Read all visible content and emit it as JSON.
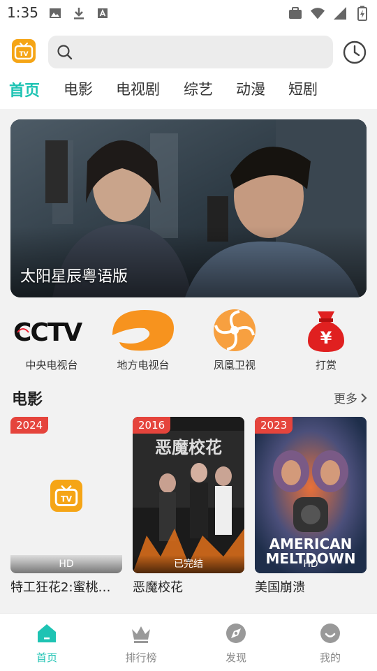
{
  "status_bar": {
    "time": "1:35"
  },
  "header": {
    "search": {
      "placeholder": "",
      "value": ""
    }
  },
  "tabs": [
    {
      "label": "首页"
    },
    {
      "label": "电影"
    },
    {
      "label": "电视剧"
    },
    {
      "label": "综艺"
    },
    {
      "label": "动漫"
    },
    {
      "label": "短剧"
    }
  ],
  "banner": {
    "title": "太阳星辰粤语版"
  },
  "channels": [
    {
      "label": "中央电视台",
      "icon": "cctv-logo-icon"
    },
    {
      "label": "地方电视台",
      "icon": "local-tv-icon"
    },
    {
      "label": "凤凰卫视",
      "icon": "phoenix-tv-icon"
    },
    {
      "label": "打赏",
      "icon": "money-bag-icon"
    }
  ],
  "movies_section": {
    "title": "电影",
    "more_label": "更多",
    "items": [
      {
        "year": "2024",
        "badge": "HD",
        "title": "特工狂花2:蜜桃…"
      },
      {
        "year": "2016",
        "badge": "已完结",
        "title": "恶魔校花",
        "poster_text": "恶魔校花"
      },
      {
        "year": "2023",
        "badge": "HD",
        "title": "美国崩溃",
        "poster_text": "AMERICAN MELTDOWN"
      }
    ]
  },
  "bottom_nav": [
    {
      "label": "首页"
    },
    {
      "label": "排行榜"
    },
    {
      "label": "发现"
    },
    {
      "label": "我的"
    }
  ],
  "colors": {
    "accent": "#1ec3b3",
    "brand_orange": "#f5a516",
    "badge_red": "#e5443c"
  }
}
